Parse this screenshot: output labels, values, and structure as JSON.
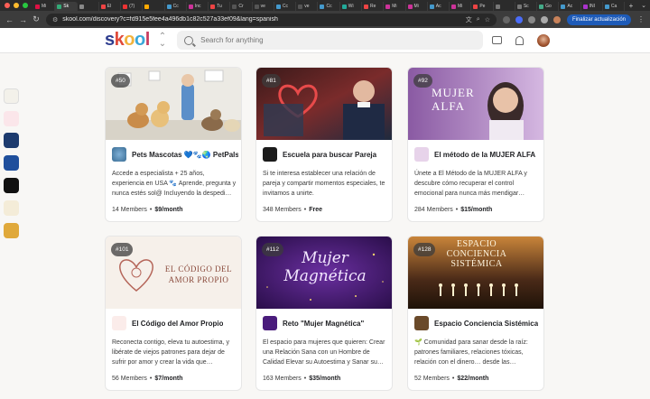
{
  "browser": {
    "tabs": [
      "Mi",
      "Sk",
      "",
      "El",
      "(7)",
      "",
      "Cc",
      "Inc",
      "Tu",
      "Cr",
      "ve",
      "Cc",
      "ve",
      "Cc",
      "Wi",
      "Re",
      "Mi",
      "Mi",
      "Ac",
      "Mi",
      "Pe",
      "",
      "Sc",
      "Go",
      "Ac",
      "INI",
      "Ca"
    ],
    "url": "skool.com/discovery?c=fd915e5fee4a496db1c82c527a33ef09&lang=spanish",
    "update_button": "Finalizar actualización"
  },
  "header": {
    "logo": [
      "s",
      "k",
      "o",
      "o",
      "l"
    ],
    "logo_colors": [
      "#2e3d8f",
      "#e04a3a",
      "#f2b33d",
      "#3aa7d9",
      "#c73c5f"
    ],
    "search_placeholder": "Search for anything"
  },
  "cards": [
    {
      "rank": "#50",
      "name": "Pets Mascotas 💙🐾🌏 PetPals",
      "description": "Accede a especialista + 25 años, experiencia en USA 🐾 Aprende, pregunta y nunca estés sol@ Incluyendo la despedi…",
      "members": "14 Members",
      "price": "$9/month"
    },
    {
      "rank": "#81",
      "name": "Escuela para buscar Pareja",
      "description": "Si te interesa establecer una relación de pareja y compartir momentos especiales, te invitamos a unirte.",
      "members": "348 Members",
      "price": "Free"
    },
    {
      "rank": "#92",
      "name": "El método de la MUJER ALFA",
      "description": "Únete a El Método de la MUJER ALFA y descubre cómo recuperar el control emocional para nunca más mendigar…",
      "members": "284 Members",
      "price": "$15/month",
      "cover_text": "MUJER ALFA"
    },
    {
      "rank": "#101",
      "name": "El Código del Amor Propio",
      "description": "Reconecta contigo, eleva tu autoestima, y libérate de viejos patrones para dejar de sufrir por amor y crear la vida que…",
      "members": "56 Members",
      "price": "$7/month",
      "cover_text": "EL CÓDIGO DEL AMOR PROPIO"
    },
    {
      "rank": "#112",
      "name": "Reto \"Mujer Magnética\"",
      "description": "El espacio para mujeres que quieren: Crear una Relación Sana con un Hombre de Calidad Elevar su Autoestima y Sanar su…",
      "members": "163 Members",
      "price": "$35/month",
      "cover_text": "Mujer Magnética"
    },
    {
      "rank": "#128",
      "name": "Espacio Conciencia Sistémica",
      "description": "🌱 Comunidad para sanar desde la raíz: patrones familiares, relaciones tóxicas, relación con el dinero… desde las…",
      "members": "52 Members",
      "price": "$22/month",
      "cover_text": "ESPACIO CONCIENCIA SISTÉMICA"
    }
  ],
  "colors": {
    "accent_blue": "#1e5bb8",
    "page_bg": "#f8f7f5"
  }
}
